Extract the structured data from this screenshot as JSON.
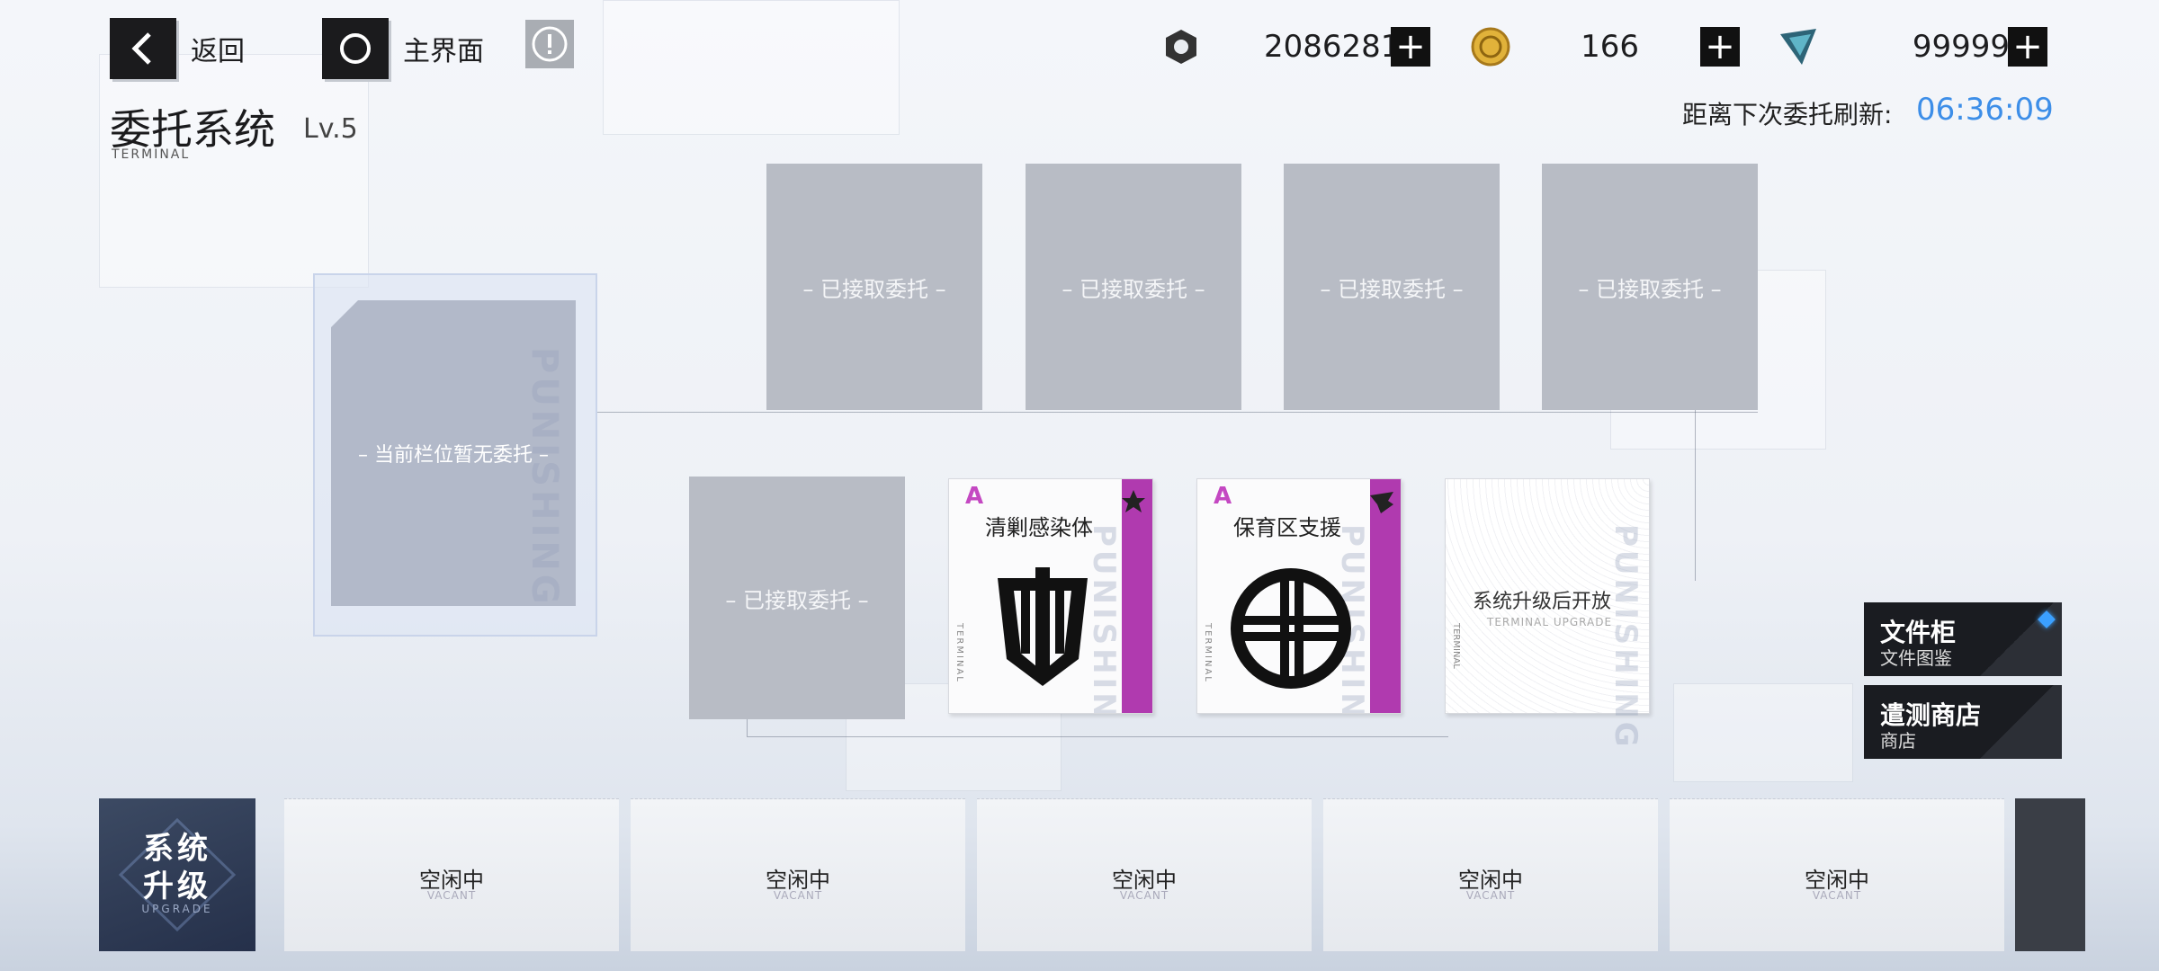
{
  "topbar": {
    "back_label": "返回",
    "home_label": "主界面",
    "currencies": [
      {
        "icon": "hex-nut-icon",
        "value": "20862819"
      },
      {
        "icon": "gold-coin-icon",
        "value": "166"
      },
      {
        "icon": "crystal-icon",
        "value": "99999"
      }
    ],
    "plus_label": "+"
  },
  "header": {
    "title": "委托系统",
    "level": "Lv.5",
    "subtitle": "TERMINAL",
    "refresh_label": "距离下次委托刷新:",
    "refresh_time": "06:36:09"
  },
  "slots": {
    "big_slot_text": "– 当前栏位暂无委托 –",
    "accepted_text": "– 已接取委托 –"
  },
  "cards": [
    {
      "title": "清剿感染体",
      "emblem": "tower-emblem-icon",
      "corner": "star-badge-icon",
      "mark": "A"
    },
    {
      "title": "保育区支援",
      "emblem": "cross-circle-emblem-icon",
      "corner": "wing-badge-icon",
      "mark": "A"
    }
  ],
  "locked_card": {
    "title": "系统升级后开放",
    "subtitle": "TERMINAL UPGRADE"
  },
  "watermark": "PUNISHING",
  "terminal_small": "TERMINAL",
  "side_buttons": [
    {
      "title": "文件柜",
      "subtitle": "文件图鉴"
    },
    {
      "title": "遣测商店",
      "subtitle": "商店"
    }
  ],
  "upgrade": {
    "line1": "系统",
    "line2": "升级",
    "sub": "UPGRADE"
  },
  "vacant_slots": [
    {
      "label": "空闲中",
      "sub": "VACANT"
    },
    {
      "label": "空闲中",
      "sub": "VACANT"
    },
    {
      "label": "空闲中",
      "sub": "VACANT"
    },
    {
      "label": "空闲中",
      "sub": "VACANT"
    },
    {
      "label": "空闲中",
      "sub": "VACANT"
    }
  ],
  "colors": {
    "accent_blue": "#3d8ee8",
    "card_stripe": "#b03aaf",
    "dark": "#1b1b1d"
  }
}
